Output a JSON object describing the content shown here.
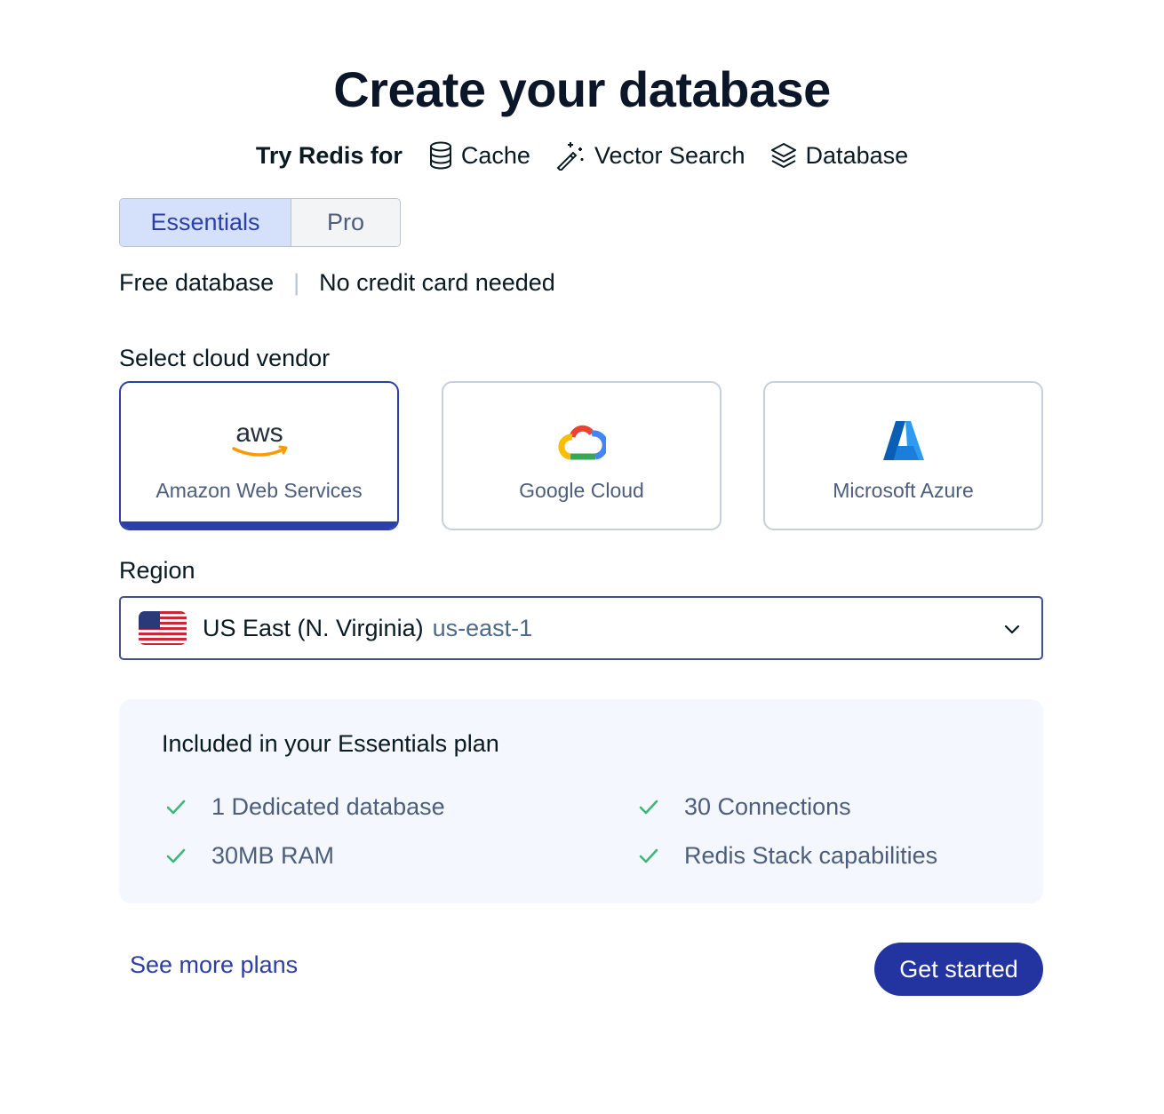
{
  "header": {
    "title": "Create your database"
  },
  "try_redis": {
    "label": "Try Redis for",
    "items": [
      {
        "label": "Cache",
        "icon": "database-cylinder-icon"
      },
      {
        "label": "Vector Search",
        "icon": "magic-wand-icon"
      },
      {
        "label": "Database",
        "icon": "layers-icon"
      }
    ]
  },
  "plan_toggle": {
    "options": [
      "Essentials",
      "Pro"
    ],
    "selected": "Essentials"
  },
  "plan_info": {
    "free": "Free database",
    "separator": "|",
    "no_card": "No credit card needed"
  },
  "vendor": {
    "label": "Select cloud vendor",
    "options": [
      {
        "name": "Amazon Web Services",
        "logo_text": "aws",
        "icon": "aws-logo-icon",
        "selected": true
      },
      {
        "name": "Google Cloud",
        "icon": "google-cloud-logo-icon",
        "selected": false
      },
      {
        "name": "Microsoft Azure",
        "icon": "azure-logo-icon",
        "selected": false
      }
    ]
  },
  "region": {
    "label": "Region",
    "selected_name": "US East (N. Virginia)",
    "selected_code": "us-east-1",
    "flag_icon": "us-flag-icon"
  },
  "included": {
    "title": "Included in your Essentials plan",
    "features": [
      "1 Dedicated database",
      "30 Connections",
      "30MB RAM",
      "Redis Stack capabilities"
    ],
    "check_color": "#3cb878"
  },
  "footer": {
    "more_plans": "See more plans",
    "get_started": "Get started"
  },
  "colors": {
    "accent": "#2c3ea8",
    "button": "#2334a0",
    "selected_tab_bg": "#d5e0fb"
  }
}
